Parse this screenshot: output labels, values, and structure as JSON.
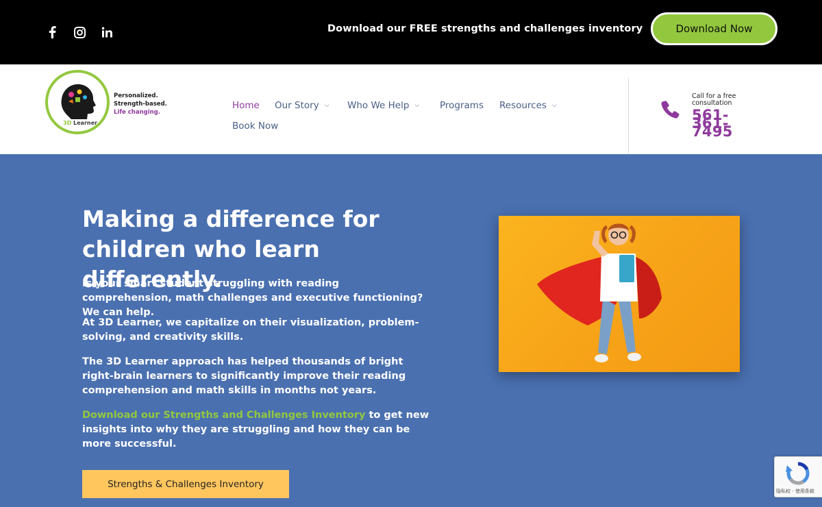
{
  "topbar": {
    "social_icons": [
      "facebook-icon",
      "instagram-icon",
      "linkedin-icon"
    ],
    "promo_text": "Download our FREE strengths and challenges inventory",
    "download_button": "Download Now"
  },
  "header": {
    "logo": {
      "word_3d": "3D",
      "word_learner": "Learner",
      "tagline_1": "Personalized.",
      "tagline_2": "Strength-based.",
      "tagline_3": "Life changing."
    },
    "nav": {
      "home": "Home",
      "our_story": "Our Story",
      "who_we_help": "Who We Help",
      "programs": "Programs",
      "resources": "Resources",
      "book_now": "Book Now"
    },
    "call_label": "Call for a free consultation",
    "phone_number": "561-361-7495"
  },
  "hero": {
    "title": "Making a difference for children who learn differently.",
    "paragraph_1": "Is your smart student struggling with reading comprehension, math challenges and executive functioning? We can help.",
    "paragraph_2": "At 3D Learner, we capitalize on their visualization, problem-solving, and creativity skills.",
    "paragraph_3": "The 3D Learner approach has helped thousands of bright right-brain learners to significantly improve their reading comprehension and math skills in months not years.",
    "paragraph_4_link": "Download our Strengths and Challenges Inventory",
    "paragraph_4_rest": " to get new insights into why they are struggling and how they can be more successful.",
    "cta_button": "Strengths & Challenges Inventory"
  },
  "recaptcha": {
    "text": "隐私权 - 使用条款"
  },
  "colors": {
    "brand_green": "#93c83e",
    "brand_purple": "#8e3a9c",
    "hero_blue": "#4a70b0",
    "cta_yellow": "#ffc65e"
  }
}
